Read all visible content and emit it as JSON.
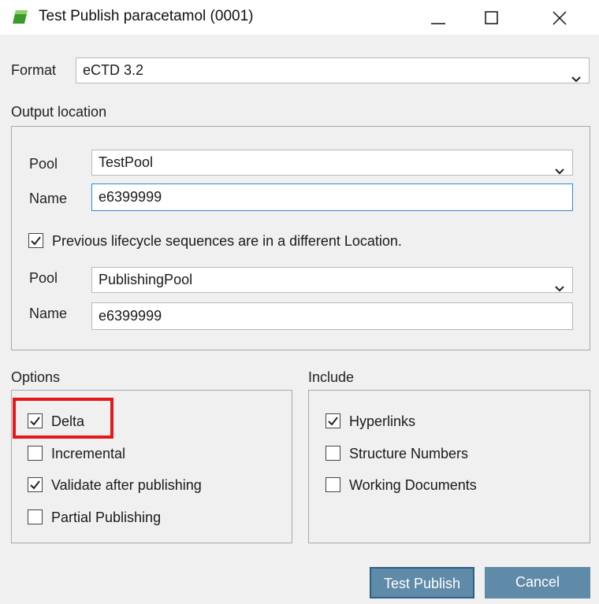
{
  "window": {
    "title": "Test Publish paracetamol (0001)",
    "icon": "app-icon-green-flag",
    "controls": [
      "minimize-icon",
      "maximize-icon",
      "close-icon"
    ]
  },
  "format": {
    "label": "Format",
    "value": "eCTD 3.2"
  },
  "output_location": {
    "label": "Output location",
    "pool_label": "Pool",
    "pool_value": "TestPool",
    "name_label": "Name",
    "name_value": "e6399999",
    "lifecycle_checkbox": {
      "label": "Previous lifecycle sequences are in a different Location.",
      "checked": true
    },
    "prev_pool_label": "Pool",
    "prev_pool_value": "PublishingPool",
    "prev_name_label": "Name",
    "prev_name_value": "e6399999"
  },
  "options": {
    "label": "Options",
    "items": [
      {
        "label": "Delta",
        "checked": true
      },
      {
        "label": "Incremental",
        "checked": false
      },
      {
        "label": "Validate after publishing",
        "checked": true
      },
      {
        "label": "Partial Publishing",
        "checked": false
      }
    ]
  },
  "include": {
    "label": "Include",
    "items": [
      {
        "label": "Hyperlinks",
        "checked": true
      },
      {
        "label": "Structure Numbers",
        "checked": false
      },
      {
        "label": "Working Documents",
        "checked": false
      }
    ]
  },
  "buttons": {
    "test_publish": "Test Publish",
    "cancel": "Cancel"
  },
  "colors": {
    "highlight": "#e41818",
    "button_bg": "#5f8aa8",
    "button_border": "#2c5f86",
    "focus_border": "#2f88d8"
  }
}
